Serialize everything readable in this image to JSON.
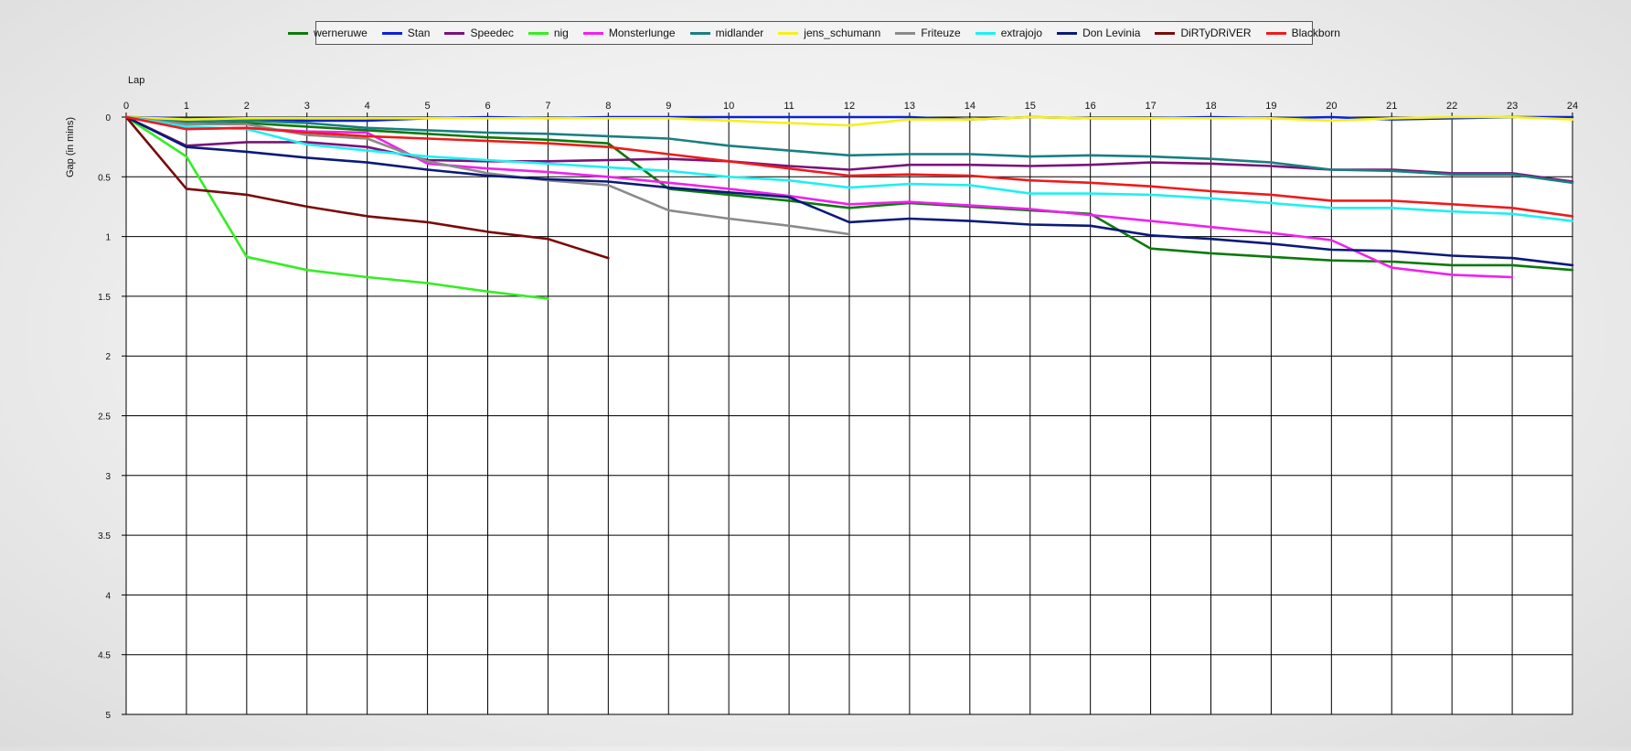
{
  "chart_data": {
    "type": "line",
    "title": "",
    "xlabel": "Lap",
    "ylabel": "Gap (in mins)",
    "xlim": [
      0,
      24
    ],
    "ylim": [
      0,
      5
    ],
    "y_inverted": true,
    "grid": true,
    "legend_position": "top",
    "x_ticks": [
      "0",
      "1",
      "2",
      "3",
      "4",
      "5",
      "6",
      "7",
      "8",
      "9",
      "10",
      "11",
      "12",
      "13",
      "14",
      "15",
      "16",
      "17",
      "18",
      "19",
      "20",
      "21",
      "22",
      "23",
      "24"
    ],
    "y_ticks": [
      "0",
      "0.5",
      "1",
      "1.5",
      "2",
      "2.5",
      "3",
      "3.5",
      "4",
      "4.5",
      "5"
    ],
    "series": [
      {
        "name": "werneruwe",
        "color": "#0b7a0b",
        "x": [
          0,
          1,
          2,
          3,
          4,
          5,
          6,
          7,
          8,
          9,
          10,
          11,
          12,
          13,
          14,
          15,
          16,
          17,
          18,
          19,
          20,
          21,
          22,
          23,
          24
        ],
        "y": [
          0,
          0.06,
          0.05,
          0.08,
          0.11,
          0.14,
          0.17,
          0.19,
          0.22,
          0.6,
          0.65,
          0.7,
          0.76,
          0.72,
          0.75,
          0.78,
          0.81,
          1.1,
          1.14,
          1.17,
          1.2,
          1.21,
          1.24,
          1.24,
          1.28
        ]
      },
      {
        "name": "Stan",
        "color": "#0a22d6",
        "x": [
          0,
          1,
          2,
          3,
          4,
          5,
          6,
          7,
          8,
          9,
          10,
          11,
          12,
          13,
          14,
          15,
          16,
          17,
          18,
          19,
          20,
          21,
          22,
          23,
          24
        ],
        "y": [
          0,
          0.01,
          0.02,
          0.03,
          0.03,
          0.01,
          0,
          0.01,
          0,
          0,
          0,
          0,
          0,
          0,
          0.02,
          0,
          0.01,
          0.01,
          0,
          0.01,
          0,
          0.02,
          0.01,
          0,
          0
        ]
      },
      {
        "name": "Speedec",
        "color": "#7a127a",
        "x": [
          0,
          1,
          2,
          3,
          4,
          5,
          6,
          7,
          8,
          9,
          10,
          11,
          12,
          13,
          14,
          15,
          16,
          17,
          18,
          19,
          20,
          21,
          22,
          23,
          24
        ],
        "y": [
          0,
          0.24,
          0.21,
          0.21,
          0.25,
          0.36,
          0.37,
          0.37,
          0.36,
          0.35,
          0.37,
          0.41,
          0.44,
          0.4,
          0.4,
          0.41,
          0.4,
          0.38,
          0.39,
          0.41,
          0.44,
          0.44,
          0.47,
          0.47,
          0.54
        ]
      },
      {
        "name": "nig",
        "color": "#33ee22",
        "x": [
          0,
          1,
          2,
          3,
          4,
          5,
          6,
          7
        ],
        "y": [
          0,
          0.33,
          1.17,
          1.28,
          1.34,
          1.39,
          1.46,
          1.52
        ]
      },
      {
        "name": "Monsterlunge",
        "color": "#f020f0",
        "x": [
          0,
          1,
          2,
          3,
          4,
          5,
          6,
          7,
          8,
          9,
          10,
          11,
          12,
          13,
          14,
          15,
          16,
          17,
          18,
          19,
          20,
          21,
          22,
          23
        ],
        "y": [
          0,
          0.1,
          0.09,
          0.12,
          0.13,
          0.39,
          0.43,
          0.46,
          0.5,
          0.55,
          0.6,
          0.66,
          0.73,
          0.71,
          0.74,
          0.77,
          0.82,
          0.87,
          0.92,
          0.97,
          1.03,
          1.26,
          1.32,
          1.34
        ]
      },
      {
        "name": "midlander",
        "color": "#1a7f80",
        "x": [
          0,
          1,
          2,
          3,
          4,
          5,
          6,
          7,
          8,
          9,
          10,
          11,
          12,
          13,
          14,
          15,
          16,
          17,
          18,
          19,
          20,
          21,
          22,
          23,
          24
        ],
        "y": [
          0,
          0.04,
          0.03,
          0.05,
          0.09,
          0.11,
          0.13,
          0.14,
          0.16,
          0.18,
          0.24,
          0.28,
          0.32,
          0.31,
          0.31,
          0.33,
          0.32,
          0.33,
          0.35,
          0.38,
          0.44,
          0.45,
          0.48,
          0.48,
          0.55
        ]
      },
      {
        "name": "jens_schumann",
        "color": "#f4f01c",
        "x": [
          0,
          1,
          2,
          3,
          4,
          5,
          6,
          7,
          8,
          9,
          10,
          11,
          12,
          13,
          14,
          15,
          16,
          17,
          18,
          19,
          20,
          21,
          22,
          23,
          24
        ],
        "y": [
          0,
          0.02,
          0.01,
          0.01,
          0.01,
          0.01,
          0.01,
          0.01,
          0.01,
          0.01,
          0.03,
          0.05,
          0.07,
          0.02,
          0.02,
          0,
          0.01,
          0.01,
          0.01,
          0.01,
          0.03,
          0.01,
          0,
          0,
          0.02
        ]
      },
      {
        "name": "Friteuze",
        "color": "#8a8a8a",
        "x": [
          0,
          1,
          2,
          3,
          4,
          5,
          6,
          7,
          8,
          9,
          10,
          11,
          12
        ],
        "y": [
          0,
          0.06,
          0.06,
          0.15,
          0.18,
          0.37,
          0.47,
          0.53,
          0.57,
          0.78,
          0.85,
          0.91,
          0.98
        ]
      },
      {
        "name": "extrajojo",
        "color": "#1ef0f0",
        "x": [
          0,
          1,
          2,
          3,
          4,
          5,
          6,
          7,
          8,
          9,
          10,
          11,
          12,
          13,
          14,
          15,
          16,
          17,
          18,
          19,
          20,
          21,
          22,
          23,
          24
        ],
        "y": [
          0,
          0.08,
          0.1,
          0.23,
          0.28,
          0.33,
          0.36,
          0.39,
          0.42,
          0.45,
          0.5,
          0.53,
          0.59,
          0.56,
          0.57,
          0.64,
          0.64,
          0.65,
          0.68,
          0.72,
          0.76,
          0.76,
          0.79,
          0.81,
          0.87
        ]
      },
      {
        "name": "Don Levinia",
        "color": "#0a1a78",
        "x": [
          0,
          1,
          2,
          3,
          4,
          5,
          6,
          7,
          8,
          9,
          10,
          11,
          12,
          13,
          14,
          15,
          16,
          17,
          18,
          19,
          20,
          21,
          22,
          23,
          24
        ],
        "y": [
          0,
          0.25,
          0.29,
          0.34,
          0.38,
          0.44,
          0.49,
          0.52,
          0.54,
          0.59,
          0.63,
          0.67,
          0.88,
          0.85,
          0.87,
          0.9,
          0.91,
          0.99,
          1.02,
          1.06,
          1.11,
          1.12,
          1.16,
          1.18,
          1.24
        ]
      },
      {
        "name": "DiRTyDRiVER",
        "color": "#7a0a0a",
        "x": [
          0,
          1,
          2,
          3,
          4,
          5,
          6,
          7,
          8
        ],
        "y": [
          0,
          0.6,
          0.65,
          0.75,
          0.83,
          0.88,
          0.96,
          1.02,
          1.18
        ]
      },
      {
        "name": "Blackborn",
        "color": "#f01a1a",
        "x": [
          0,
          1,
          2,
          3,
          4,
          5,
          6,
          7,
          8,
          9,
          10,
          11,
          12,
          13,
          14,
          15,
          16,
          17,
          18,
          19,
          20,
          21,
          22,
          23,
          24
        ],
        "y": [
          0,
          0.1,
          0.09,
          0.13,
          0.16,
          0.18,
          0.2,
          0.22,
          0.25,
          0.31,
          0.37,
          0.43,
          0.49,
          0.48,
          0.49,
          0.53,
          0.55,
          0.58,
          0.62,
          0.65,
          0.7,
          0.7,
          0.73,
          0.76,
          0.83
        ]
      }
    ]
  }
}
